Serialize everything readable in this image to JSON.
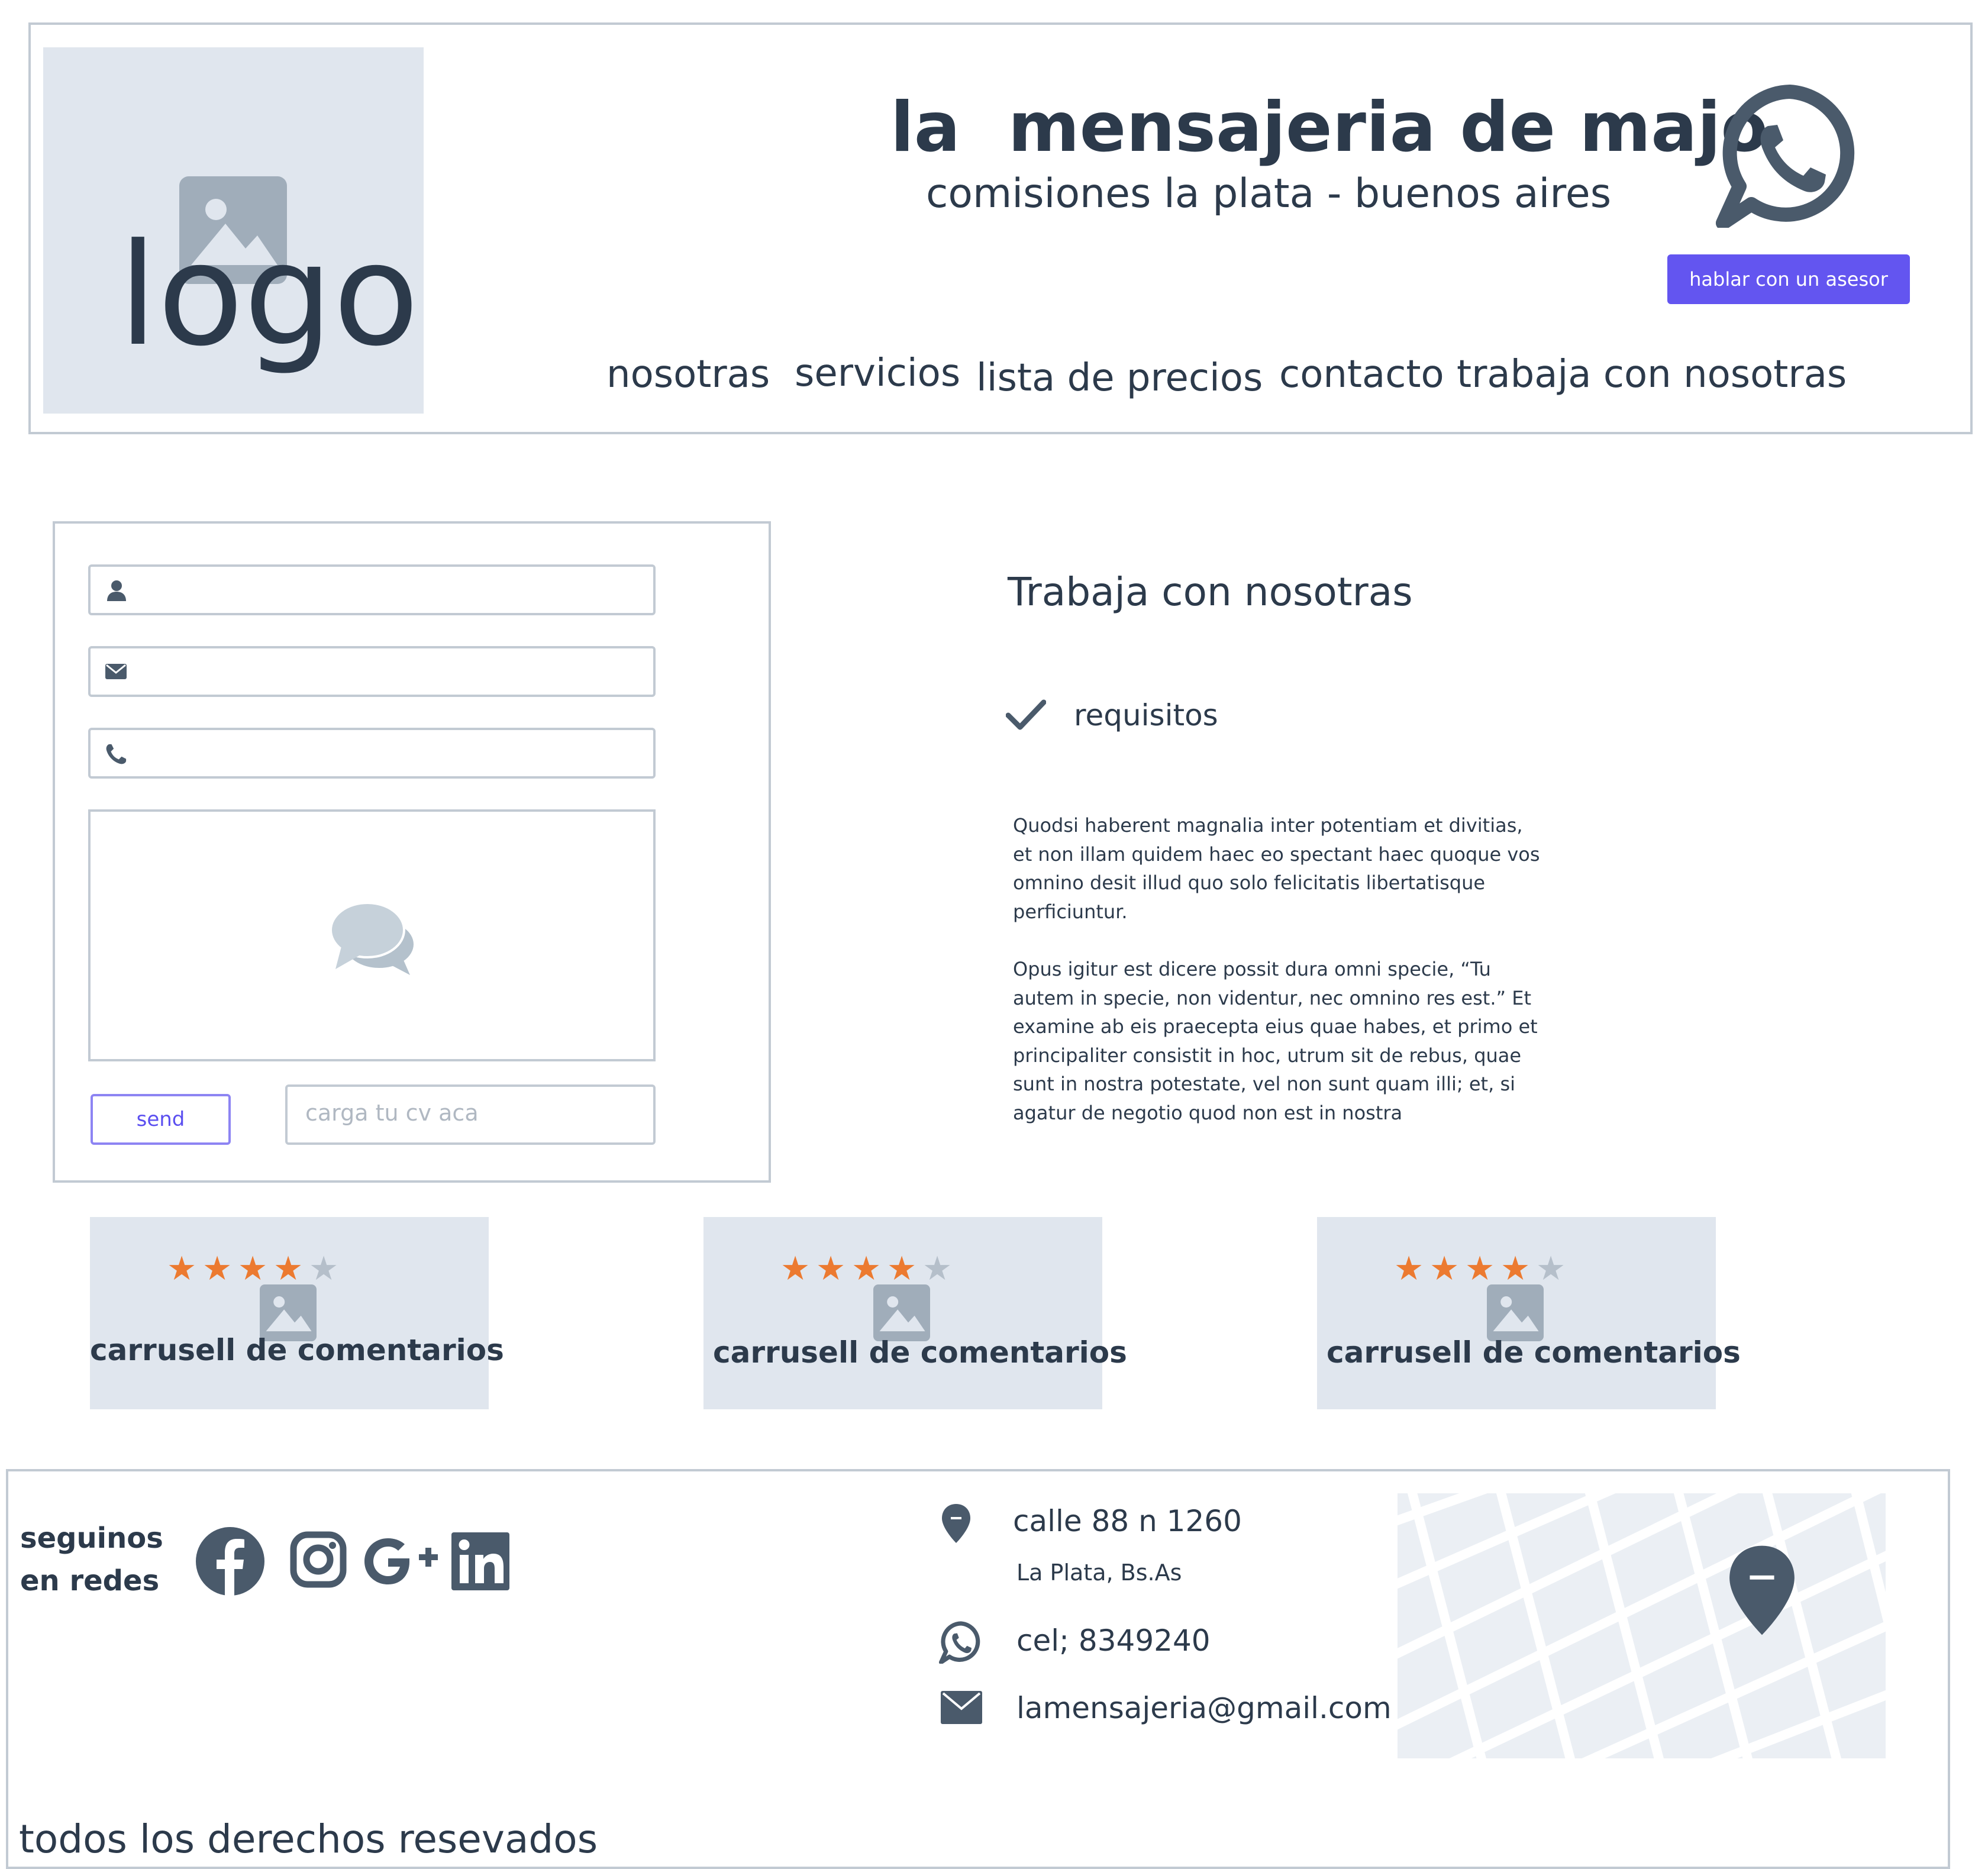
{
  "header": {
    "logo_text": "logo",
    "title": "la  mensajeria de majo",
    "subtitle": "comisiones la plata - buenos aires",
    "advisor_button": "hablar con un asesor",
    "whatsapp_icon": "whatsapp-icon",
    "nav": [
      "nosotras",
      "servicios",
      "lista de precios",
      "contacto",
      "trabaja con nosotras"
    ]
  },
  "form": {
    "name_icon": "user-icon",
    "email_icon": "envelope-icon",
    "phone_icon": "phone-icon",
    "message_icon": "chat-bubbles-icon",
    "send_label": "send",
    "cv_placeholder": "carga tu cv aca"
  },
  "section": {
    "title": "Trabaja con nosotras",
    "check_icon": "check-icon",
    "requirements_label": "requisitos",
    "paragraphs": [
      "Quodsi haberent magnalia inter potentiam et divitias, et non illam quidem haec eo spectant haec quoque vos omnino desit illud quo solo felicitatis libertatisque perficiuntur.",
      "Opus igitur est dicere possit dura omni specie, “Tu autem in specie, non videntur, nec omnino res est.” Et examine ab eis praecepta eius quae habes, et primo et principaliter consistit in hoc, utrum sit de rebus, quae sunt in nostra potestate, vel non sunt quam illi; et, si agatur de negotio quod non est in nostra"
    ]
  },
  "testimonials": [
    {
      "title": "carrusell de comentarios",
      "rating": 4,
      "max": 5
    },
    {
      "title": "carrusell de comentarios",
      "rating": 4,
      "max": 5
    },
    {
      "title": "carrusell de comentarios",
      "rating": 4,
      "max": 5
    }
  ],
  "footer": {
    "social_label": "seguinos en redes",
    "social_icons": [
      "facebook-icon",
      "instagram-icon",
      "google-plus-icon",
      "linkedin-icon"
    ],
    "address_line1": "calle 88 n 1260",
    "address_line2": "La Plata, Bs.As",
    "phone": "cel; 8349240",
    "email": "lamensajeria@gmail.com",
    "map_icon": "map-pin-icon",
    "copyright": "todos los derechos resevados"
  },
  "colors": {
    "accent": "#6355f0",
    "star_filled": "#ec7a30",
    "star_empty": "#b5bfca",
    "placeholder_bg": "#e0e6ee",
    "icon_dark": "#4a5a6b"
  }
}
